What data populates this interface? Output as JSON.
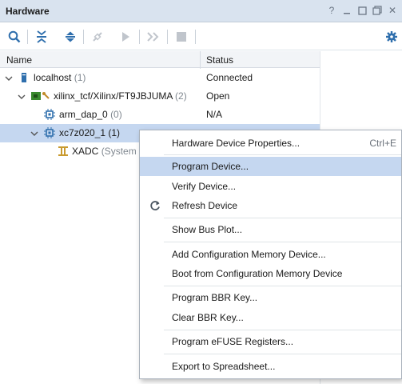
{
  "panel": {
    "title": "Hardware"
  },
  "window_buttons": [
    "help-icon",
    "minimize-icon",
    "restore-icon",
    "maximize-icon",
    "close-icon"
  ],
  "window_glyphs": {
    "help": "?",
    "close": "✕"
  },
  "toolbar": {
    "icons": [
      "search-icon",
      "collapse-all-icon",
      "expand-all-icon",
      "auto-connect-icon",
      "run-icon",
      "fast-forward-icon",
      "stop-icon",
      "gear-icon"
    ]
  },
  "tree": {
    "columns": {
      "name": "Name",
      "status": "Status"
    },
    "rows": [
      {
        "name": "localhost",
        "count": "(1)",
        "status": "Connected"
      },
      {
        "name": "xilinx_tcf/Xilinx/FT9JBJUMA",
        "count": "(2)",
        "status": "Open"
      },
      {
        "name": "arm_dap_0",
        "count": "(0)",
        "status": "N/A"
      },
      {
        "name": "xc7z020_1",
        "count": "(1)",
        "status": ""
      },
      {
        "name": "XADC",
        "count": "(System",
        "status": ""
      }
    ]
  },
  "context_menu": {
    "items": [
      {
        "label": "Hardware Device Properties...",
        "shortcut": "Ctrl+E"
      },
      {
        "label": "Program Device..."
      },
      {
        "label": "Verify Device..."
      },
      {
        "label": "Refresh Device",
        "icon": "refresh-icon"
      },
      {
        "label": "Show Bus Plot..."
      },
      {
        "label": "Add Configuration Memory Device..."
      },
      {
        "label": "Boot from Configuration Memory Device"
      },
      {
        "label": "Program BBR Key..."
      },
      {
        "label": "Clear BBR Key..."
      },
      {
        "label": "Program eFUSE Registers..."
      },
      {
        "label": "Export to Spreadsheet..."
      }
    ],
    "highlighted": "Program Device..."
  },
  "colors": {
    "header_bg": "#d9e3ef",
    "selection": "#c5d7f0",
    "accent_blue": "#2f6fad",
    "chip_green": "#3a8a2e"
  }
}
